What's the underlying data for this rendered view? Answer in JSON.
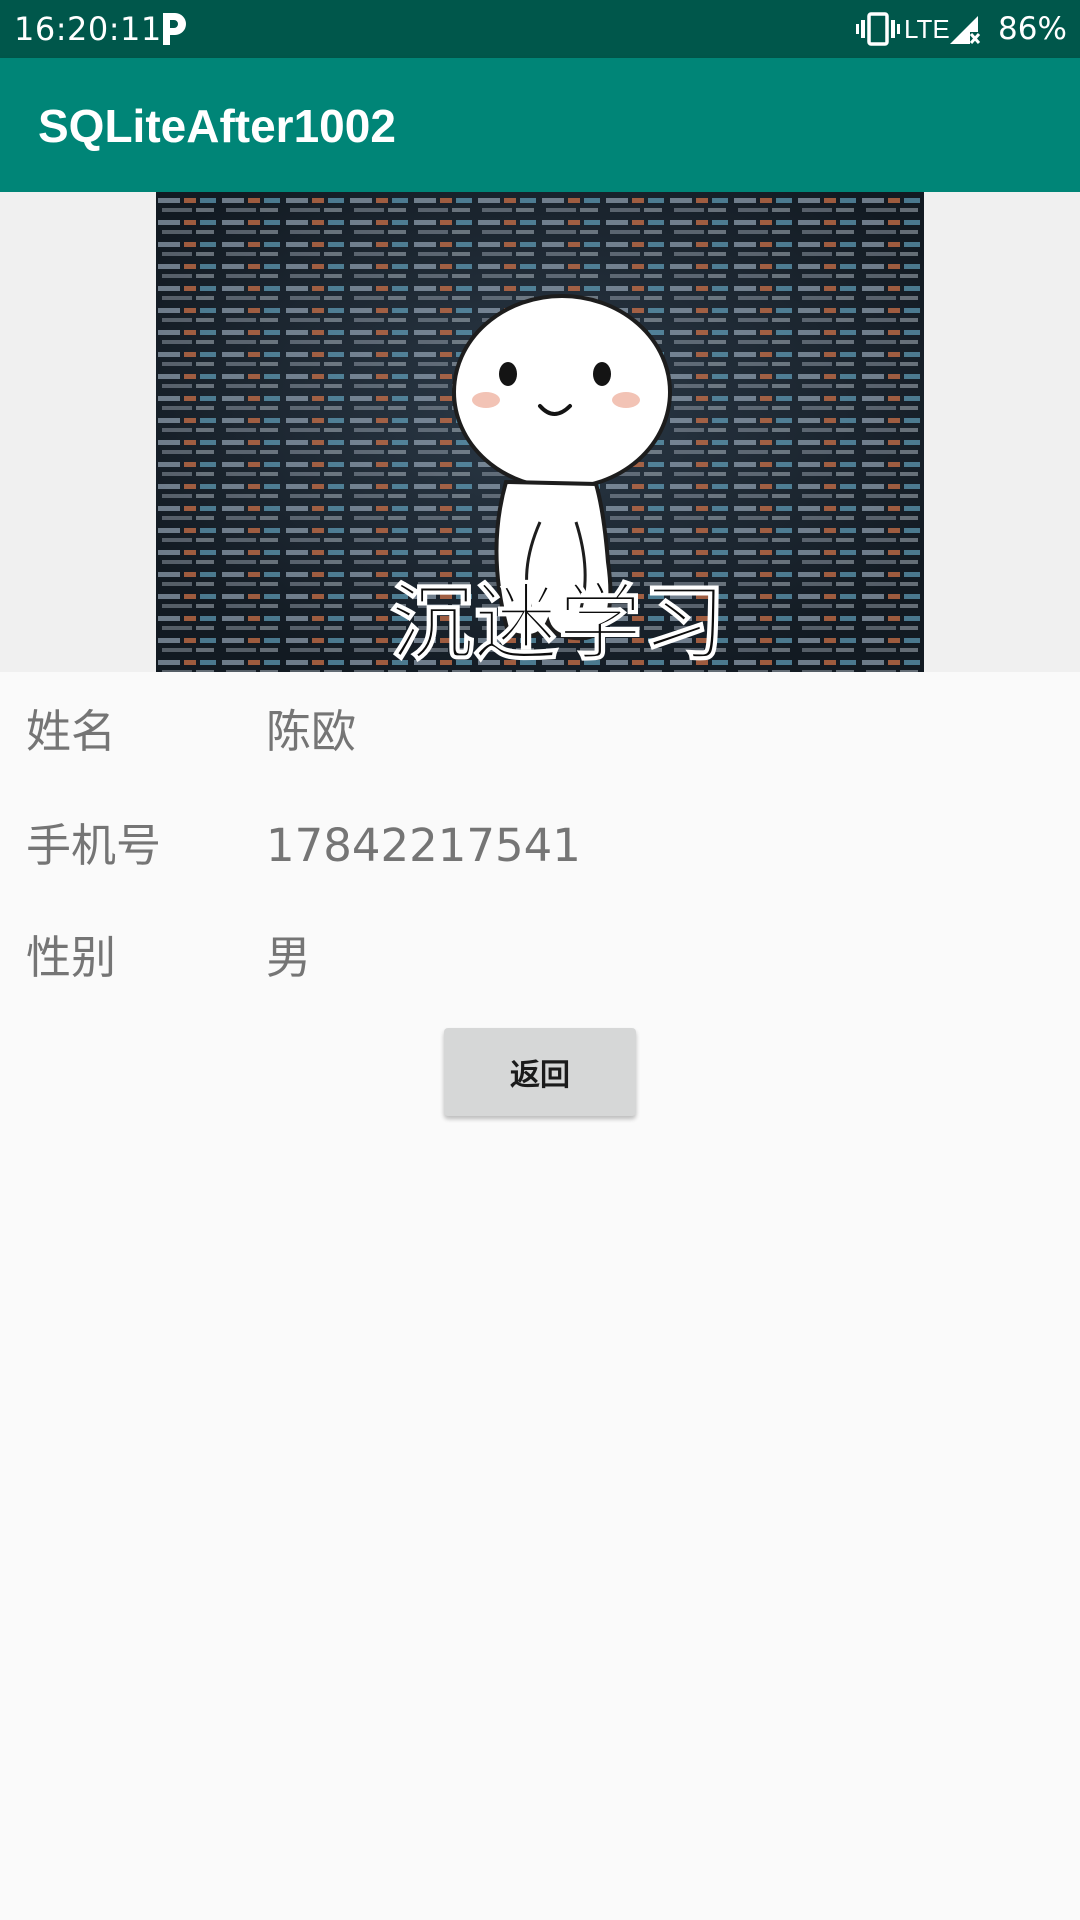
{
  "status_bar": {
    "time": "16:20:11",
    "notification_icon": "parking-p-icon",
    "vibrate_icon": "vibrate-icon",
    "network": "LTE",
    "signal_icon": "signal-no-data-icon",
    "battery": "86%"
  },
  "app_bar": {
    "title": "SQLiteAfter1002",
    "color": "#008577",
    "status_color": "#00574b"
  },
  "header_image": {
    "caption": "沉迷学习"
  },
  "fields": [
    {
      "label": "姓名",
      "value": "陈欧"
    },
    {
      "label": "手机号",
      "value": "17842217541"
    },
    {
      "label": "性别",
      "value": "男"
    }
  ],
  "back_button": {
    "label": "返回"
  }
}
